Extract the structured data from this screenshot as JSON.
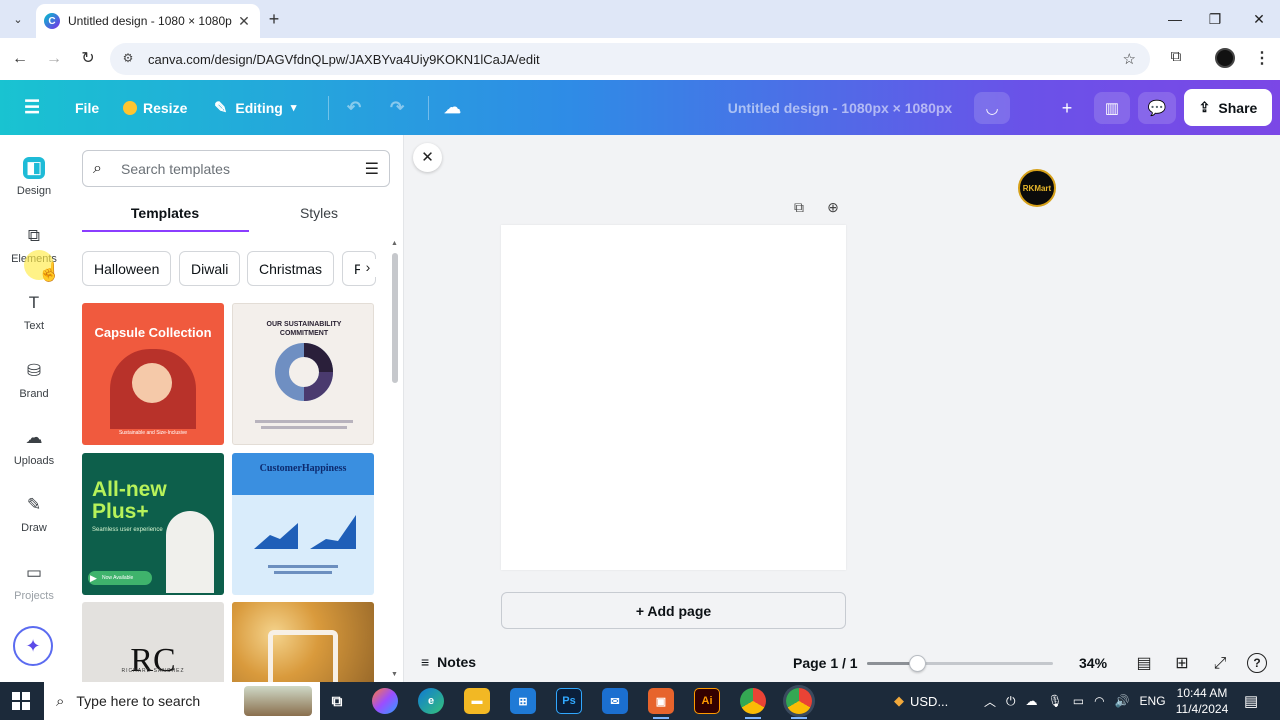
{
  "browser": {
    "tab_title": "Untitled design - 1080 × 1080p",
    "tab_close": "✕",
    "new_tab": "+",
    "url": "canva.com/design/DAGVfdnQLpw/JAXBYva4Uiy9KOKN1lCaJA/edit"
  },
  "toolbar": {
    "file": "File",
    "resize": "Resize",
    "editing": "Editing",
    "doc_title": "Untitled design - 1080px × 1080px",
    "avatar_text": "RKMart",
    "share": "Share"
  },
  "rail": {
    "items": [
      {
        "label": "Design",
        "icon": "design-icon"
      },
      {
        "label": "Elements",
        "icon": "elements-icon"
      },
      {
        "label": "Text",
        "icon": "text-icon"
      },
      {
        "label": "Brand",
        "icon": "brand-icon"
      },
      {
        "label": "Uploads",
        "icon": "uploads-icon"
      },
      {
        "label": "Draw",
        "icon": "draw-icon"
      },
      {
        "label": "Projects",
        "icon": "projects-icon"
      }
    ]
  },
  "panel": {
    "search_placeholder": "Search templates",
    "tabs": [
      "Templates",
      "Styles"
    ],
    "chips": [
      "Halloween",
      "Diwali",
      "Christmas",
      "Fa"
    ],
    "templates": [
      {
        "name": "capsule-collection",
        "title": "Capsule Collection",
        "sub": "Sustainable and Size-Inclusive"
      },
      {
        "name": "sustainability",
        "title": "OUR SUSTAINABILITY COMMITMENT"
      },
      {
        "name": "all-new-plus",
        "title": "All-new Plus+",
        "sub": "Seamless user experience",
        "badge": "Now Available"
      },
      {
        "name": "customer-happiness",
        "title": "CustomerHappiness"
      },
      {
        "name": "monogram",
        "title": "RC",
        "sub": "RICHARD SANCHEZ"
      },
      {
        "name": "floral",
        "title": ""
      }
    ]
  },
  "canvas": {
    "add_page": "+ Add page"
  },
  "bottom": {
    "notes": "Notes",
    "page": "Page 1 / 1",
    "zoom_label": "34%",
    "zoom_level": 0.34
  },
  "taskbar": {
    "search_placeholder": "Type here to search",
    "currency": "USD...",
    "lang": "ENG",
    "time": "10:44 AM",
    "date": "11/4/2024"
  },
  "colors": {
    "toolbar_start": "#19c3d1",
    "toolbar_end": "#7b47e6",
    "tab_underline": "#8b3dff"
  }
}
